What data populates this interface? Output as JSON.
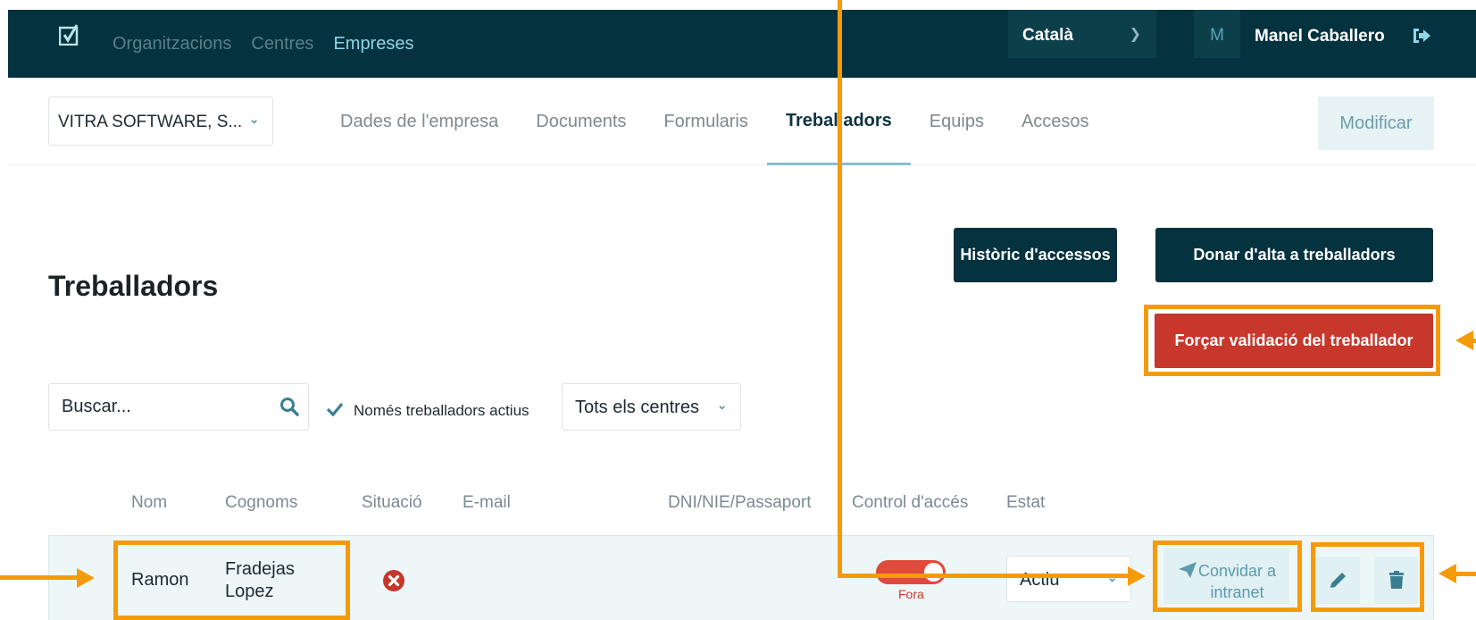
{
  "header": {
    "nav": [
      "Organitzacions",
      "Centres",
      "Empreses"
    ],
    "language": "Català",
    "avatar_initial": "M",
    "user_name": "Manel Caballero"
  },
  "company": {
    "name": "VITRA SOFTWARE, S..."
  },
  "tabs": [
    {
      "label": "Dades de l'empresa"
    },
    {
      "label": "Documents"
    },
    {
      "label": "Formularis"
    },
    {
      "label": "Treballadors",
      "active": true
    },
    {
      "label": "Equips"
    },
    {
      "label": "Accesos"
    }
  ],
  "toolbar": {
    "modify_label": "Modificar"
  },
  "page": {
    "title": "Treballadors",
    "history_button": "Històric d'accessos",
    "add_button": "Donar d'alta a treballadors",
    "force_button": "Forçar validació del treballador"
  },
  "filters": {
    "search_placeholder": "Buscar...",
    "active_only_label": "Només treballadors actius",
    "active_only_checked": true,
    "centres_value": "Tots els centres"
  },
  "table": {
    "columns": [
      "Nom",
      "Cognoms",
      "Situació",
      "E-mail",
      "DNI/NIE/Passaport",
      "Control d'accés",
      "Estat"
    ],
    "rows": [
      {
        "nom": "Ramon",
        "cognoms_1": "Fradejas",
        "cognoms_2": "Lopez",
        "situacio_icon": "error-circle-icon",
        "access_state": "Fora",
        "estat": "Actiu",
        "invite_line1": "Convidar a",
        "invite_line2": "intranet"
      }
    ]
  },
  "colors": {
    "header_bg": "#04323f",
    "danger": "#c7372b",
    "annotation": "#f59b0a",
    "accent_light": "#e0f0f3"
  }
}
